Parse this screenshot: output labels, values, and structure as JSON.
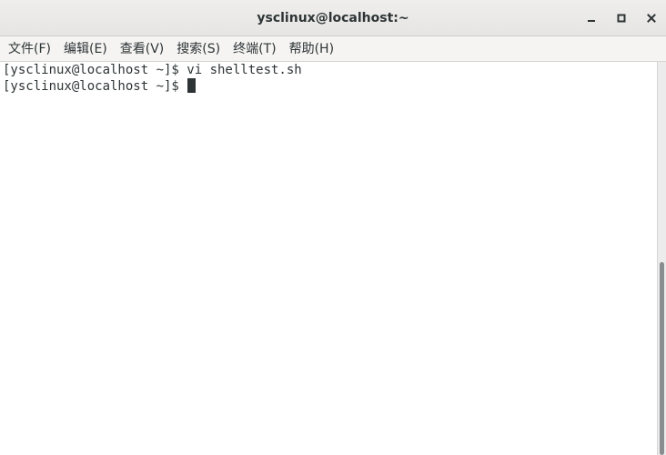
{
  "window": {
    "title": "ysclinux@localhost:~",
    "controls": {
      "minimize_icon": "minimize-icon",
      "maximize_icon": "maximize-icon",
      "close_icon": "close-icon"
    }
  },
  "menu": {
    "items": [
      {
        "label": "文件(F)"
      },
      {
        "label": "编辑(E)"
      },
      {
        "label": "查看(V)"
      },
      {
        "label": "搜索(S)"
      },
      {
        "label": "终端(T)"
      },
      {
        "label": "帮助(H)"
      }
    ]
  },
  "terminal": {
    "lines": [
      {
        "text": "[ysclinux@localhost ~]$ vi shelltest.sh"
      },
      {
        "text": "[ysclinux@localhost ~]$ "
      }
    ]
  },
  "colors": {
    "text": "#2e3436",
    "background": "#ffffff",
    "titlebar": "#e8e7e5"
  }
}
